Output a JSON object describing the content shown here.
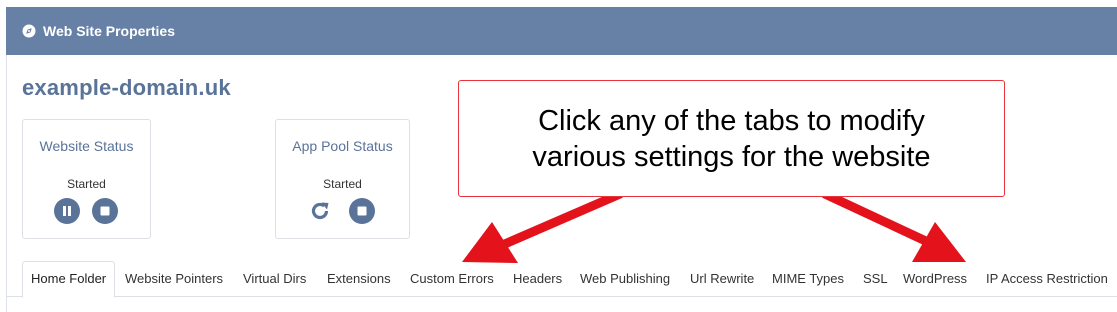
{
  "window": {
    "title": "Web Site Properties",
    "header_color": "#6780a6",
    "icon": "globe-icon"
  },
  "site": {
    "domain": "example-domain.uk"
  },
  "website_status": {
    "title": "Website Status",
    "status": "Started",
    "buttons": [
      "pause-icon",
      "stop-icon"
    ]
  },
  "app_pool_status": {
    "title": "App Pool Status",
    "status": "Started",
    "buttons": [
      "restart-icon",
      "stop-icon"
    ]
  },
  "callout": {
    "line1": "Click any of the tabs to modify",
    "line2": "various settings for the website",
    "border_color": "#e8343c",
    "arrow_color": "#e3121b"
  },
  "tabs": [
    {
      "label": "Home Folder",
      "active": true
    },
    {
      "label": "Website Pointers"
    },
    {
      "label": "Virtual Dirs"
    },
    {
      "label": "Extensions"
    },
    {
      "label": "Custom Errors"
    },
    {
      "label": "Headers"
    },
    {
      "label": "Web Publishing"
    },
    {
      "label": "Url Rewrite"
    },
    {
      "label": "MIME Types"
    },
    {
      "label": "SSL"
    },
    {
      "label": "WordPress"
    },
    {
      "label": "IP Access Restriction"
    }
  ]
}
